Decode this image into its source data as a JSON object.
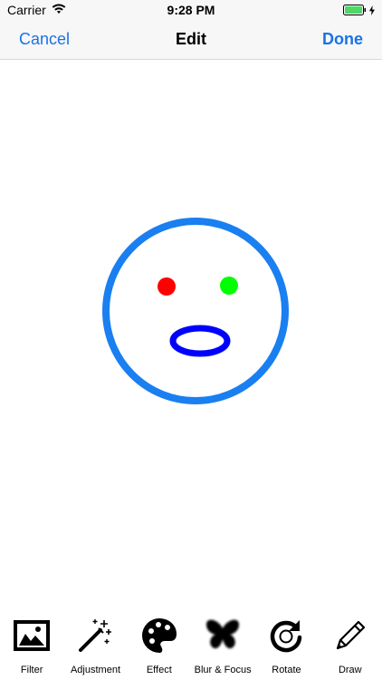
{
  "status_bar": {
    "carrier": "Carrier",
    "time": "9:28 PM",
    "battery_color": "#4cd964"
  },
  "nav": {
    "cancel_label": "Cancel",
    "title": "Edit",
    "done_label": "Done",
    "accent_color": "#1a73e8"
  },
  "canvas": {
    "face_outline_color": "#1a7ff0",
    "left_eye_color": "#ff0000",
    "right_eye_color": "#00ff00",
    "mouth_color": "#0000ff"
  },
  "toolbar": {
    "items": [
      {
        "label": "Filter",
        "icon": "image-icon"
      },
      {
        "label": "Adjustment",
        "icon": "magic-wand-icon"
      },
      {
        "label": "Effect",
        "icon": "palette-icon"
      },
      {
        "label": "Blur & Focus",
        "icon": "butterfly-icon"
      },
      {
        "label": "Rotate",
        "icon": "rotate-icon"
      },
      {
        "label": "Draw",
        "icon": "pencil-icon"
      }
    ]
  }
}
